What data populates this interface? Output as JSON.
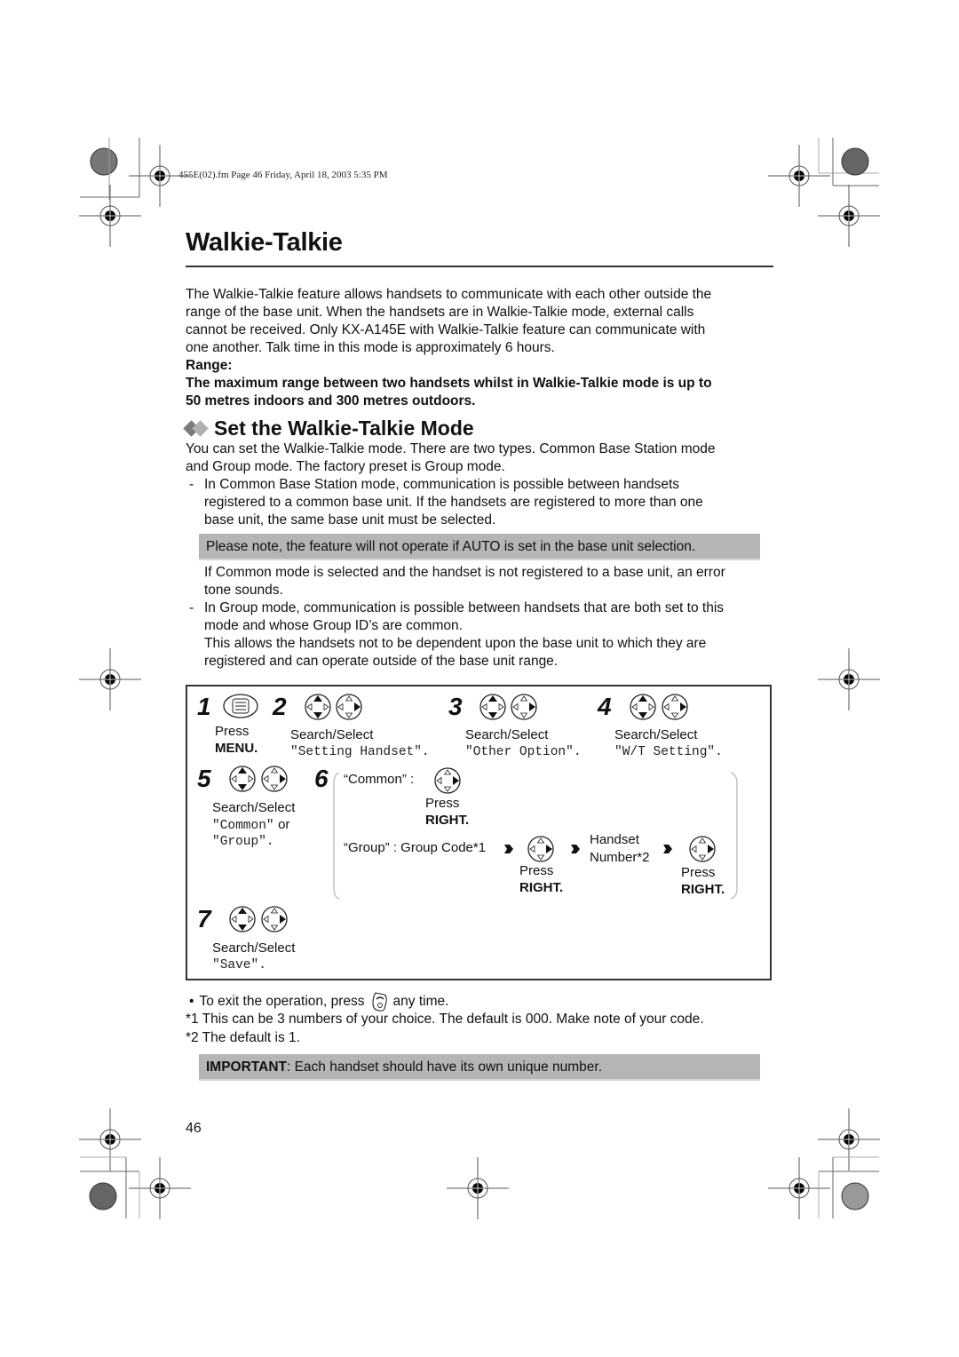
{
  "header_meta": "455E(02).fm  Page 46  Friday, April 18, 2003  5:35 PM",
  "page_title": "Walkie-Talkie",
  "intro": {
    "lines": [
      "The Walkie-Talkie feature allows handsets to communicate with each other outside the",
      "range of the base unit. When the handsets are in Walkie-Talkie mode, external calls",
      "cannot be received. Only KX-A145E with Walkie-Talkie feature can communicate with",
      "one another. Talk time in this mode is approximately 6 hours."
    ],
    "range_label": "Range:",
    "range_lines": [
      "The maximum range between two handsets whilst in Walkie-Talkie mode is up to",
      "50 metres indoors and 300 metres outdoors."
    ]
  },
  "section": {
    "title": "Set the Walkie-Talkie Mode",
    "icon": "double-diamond-icon",
    "diamond_colors": [
      "#7a7a7a",
      "#b0b0b0"
    ],
    "intro_lines": [
      "You can set the Walkie-Talkie mode. There are two types. Common Base Station mode",
      "and Group mode. The factory preset is Group mode."
    ],
    "bullet1_lines": [
      "In Common Base Station mode, communication is possible between handsets",
      "registered to a common base unit. If the handsets are registered to more than one",
      "base unit, the same base unit must be selected."
    ],
    "note": "Please note, the feature will not operate if AUTO is set in the base unit selection.",
    "after_note_lines": [
      "If Common mode is selected and the handset is not registered to a base unit, an error",
      "tone sounds."
    ],
    "bullet2_lines": [
      "In Group mode, communication is possible between handsets that are both set to this",
      "mode and whose Group ID’s are common.",
      "This allows the handsets not to be dependent upon the base unit to which they are",
      "registered and can operate outside of the base unit range."
    ],
    "dash": "-"
  },
  "procedure": {
    "steps": [
      {
        "num": "1",
        "key": "menu-key-icon",
        "action": "Press",
        "target": "MENU."
      },
      {
        "num": "2",
        "key": "navigator-up-down-right-icon",
        "action": "Search/Select",
        "target": "\"Setting Handset\"."
      },
      {
        "num": "3",
        "key": "navigator-up-down-right-icon",
        "action": "Search/Select",
        "target": "\"Other Option\"."
      },
      {
        "num": "4",
        "key": "navigator-up-down-right-icon",
        "action": "Search/Select",
        "target": "\"W/T Setting\"."
      },
      {
        "num": "5",
        "key": "navigator-up-down-right-icon",
        "action": "Search/Select",
        "target_a": "\"Common\"",
        "or": "or",
        "target_b": "\"Group\"."
      },
      {
        "num": "6",
        "common_label": "“Common” :",
        "common_press": "Press",
        "common_right": "RIGHT.",
        "group_label": "“Group” : Group Code*1",
        "group_press": "Press",
        "group_right": "RIGHT.",
        "handset_label_1": "Handset",
        "handset_label_2": "Number*2",
        "final_press": "Press",
        "final_right": "RIGHT."
      },
      {
        "num": "7",
        "key": "navigator-up-down-right-icon",
        "action": "Search/Select",
        "target": "\"Save\"."
      }
    ]
  },
  "notes": {
    "exit_bullet": "•",
    "exit_before": "To exit the operation, press",
    "exit_after": "any time.",
    "exit_key": "off-key-icon",
    "fn1": "*1 This can be 3 numbers of your choice. The default is 000. Make note of your code.",
    "fn2": "*2 The default is 1."
  },
  "important": {
    "label": "IMPORTANT",
    "text": ": Each handset should have its own unique number."
  },
  "page_number": "46",
  "colors": {
    "note_bg": "#b5b5b5",
    "text": "#111111"
  }
}
